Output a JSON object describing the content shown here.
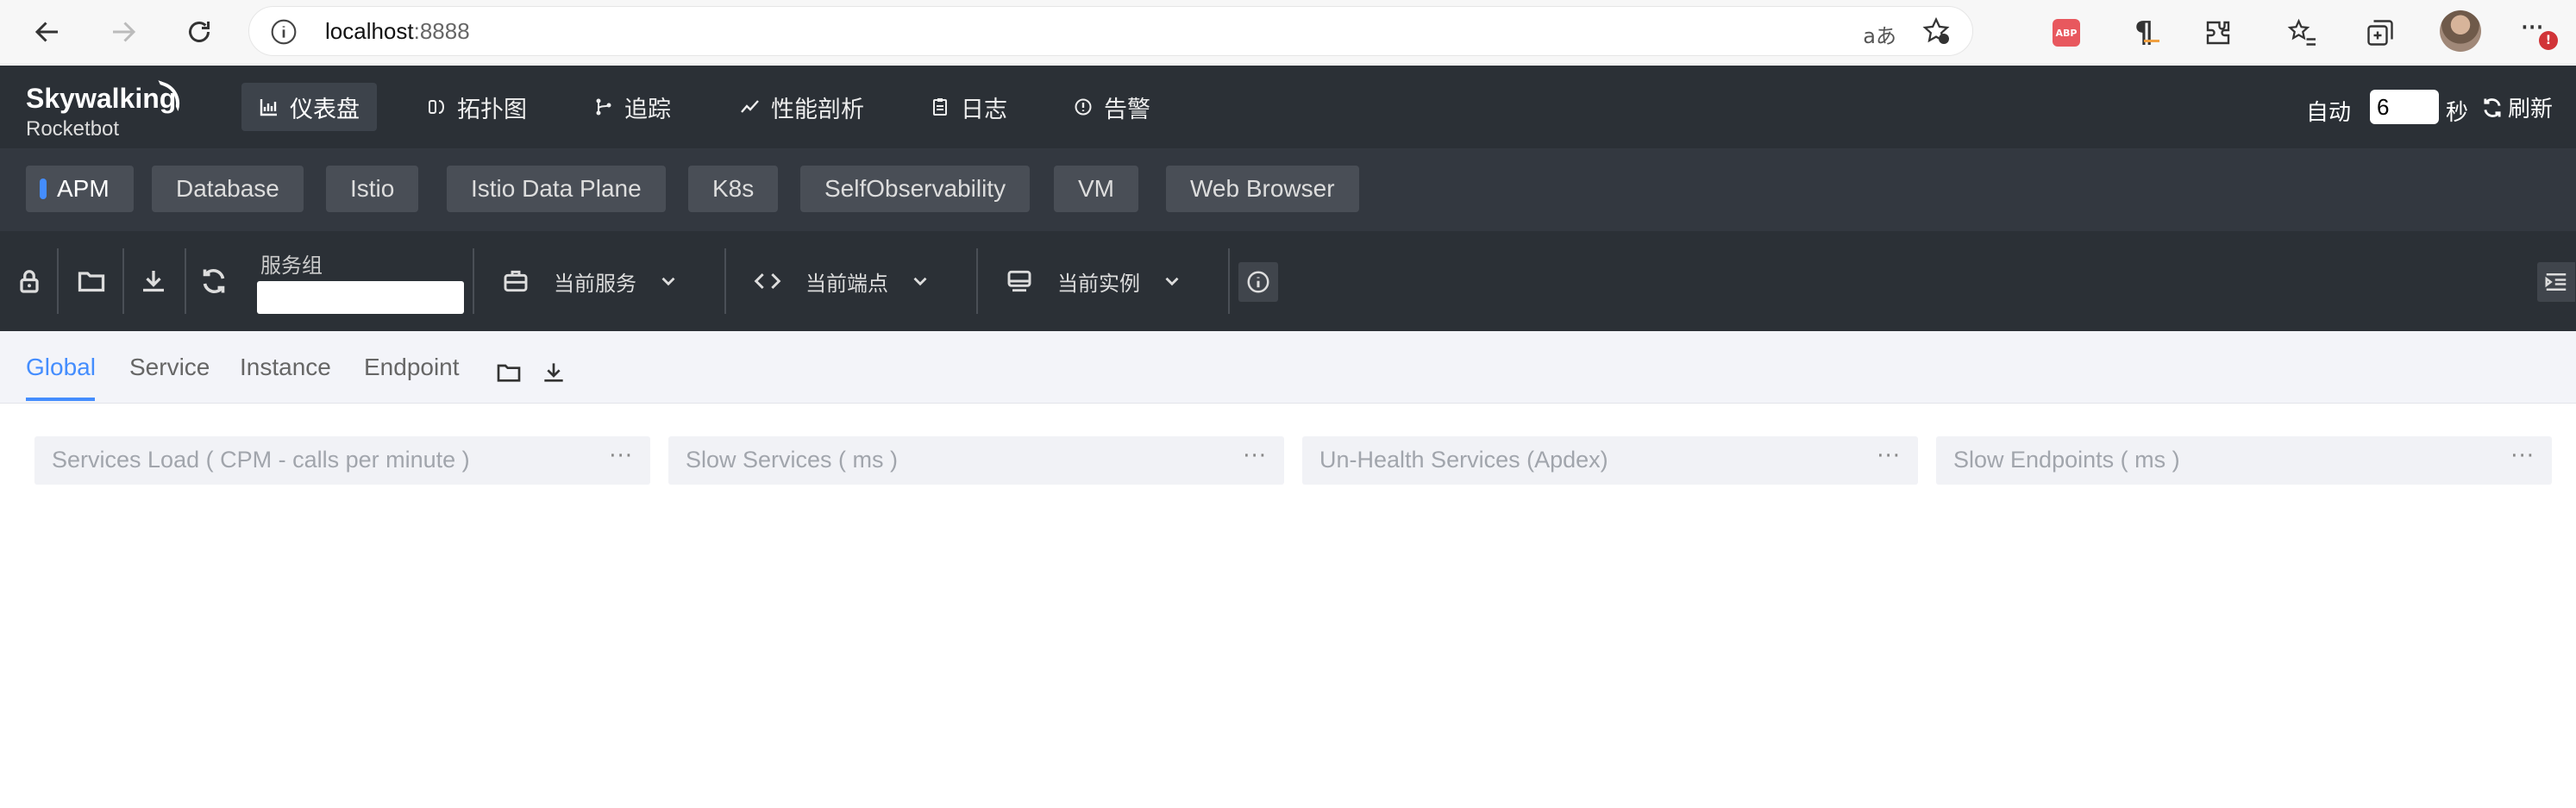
{
  "browser": {
    "url_host": "localhost",
    "url_port": ":8888",
    "read_aloud_label": "aあ",
    "more_badge": "!"
  },
  "header": {
    "logo_main": "Skywalking",
    "logo_sub": "Rocketbot",
    "nav": [
      {
        "label": "仪表盘",
        "icon": "dashboard-icon"
      },
      {
        "label": "拓扑图",
        "icon": "topology-icon"
      },
      {
        "label": "追踪",
        "icon": "trace-icon"
      },
      {
        "label": "性能剖析",
        "icon": "profile-icon"
      },
      {
        "label": "日志",
        "icon": "log-icon"
      },
      {
        "label": "告警",
        "icon": "alarm-icon"
      }
    ],
    "auto_label": "自动",
    "interval_value": "6",
    "seconds_label": "秒",
    "refresh_label": "刷新"
  },
  "layers": [
    "APM",
    "Database",
    "Istio",
    "Istio Data Plane",
    "K8s",
    "SelfObservability",
    "VM",
    "Web Browser"
  ],
  "toolbar": {
    "service_group_label": "服务组",
    "service_group_value": "",
    "current_service": "当前服务",
    "current_endpoint": "当前端点",
    "current_instance": "当前实例"
  },
  "dashboard_tabs": [
    "Global",
    "Service",
    "Instance",
    "Endpoint"
  ],
  "widgets": [
    {
      "title": "Services Load ( CPM - calls per minute )",
      "menu": "···"
    },
    {
      "title": "Slow Services ( ms )",
      "menu": "···"
    },
    {
      "title": "Un-Health Services (Apdex)",
      "menu": "···"
    },
    {
      "title": "Slow Endpoints ( ms )",
      "menu": "···"
    }
  ],
  "colors": {
    "accent": "#448dfe",
    "header_bg": "#2b3036",
    "layer_bg": "#333840",
    "tab_bg": "#f3f4f9"
  }
}
